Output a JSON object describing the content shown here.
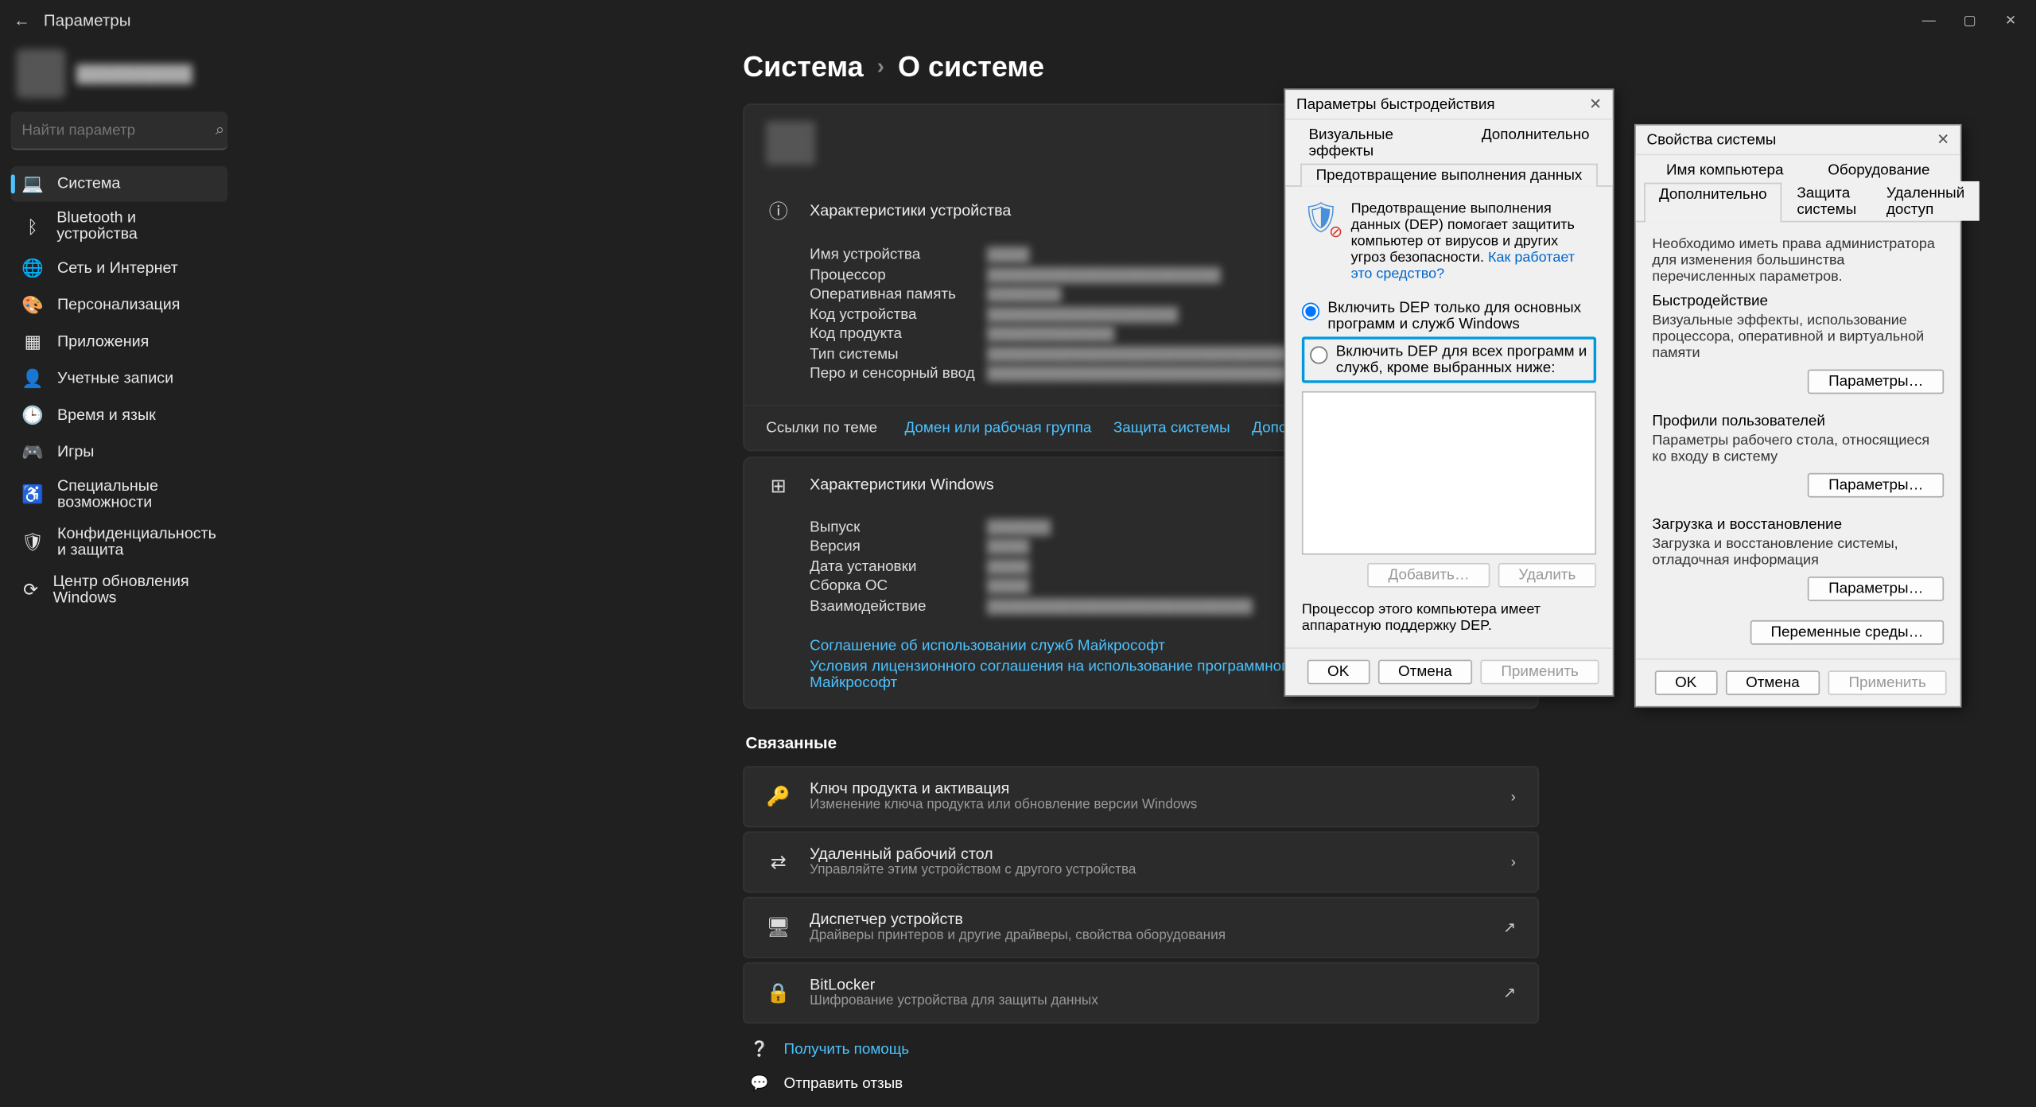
{
  "window": {
    "title": "Параметры",
    "back_aria": "Назад"
  },
  "search": {
    "placeholder": "Найти параметр"
  },
  "sidebar": {
    "items": [
      {
        "label": "Система",
        "icon": "💻",
        "active": true
      },
      {
        "label": "Bluetooth и устройства",
        "icon": "ᛒ"
      },
      {
        "label": "Сеть и Интернет",
        "icon": "🌐"
      },
      {
        "label": "Персонализация",
        "icon": "🎨"
      },
      {
        "label": "Приложения",
        "icon": "▦"
      },
      {
        "label": "Учетные записи",
        "icon": "👤"
      },
      {
        "label": "Время и язык",
        "icon": "🕒"
      },
      {
        "label": "Игры",
        "icon": "🎮"
      },
      {
        "label": "Специальные возможности",
        "icon": "♿"
      },
      {
        "label": "Конфиденциальность и защита",
        "icon": "🛡"
      },
      {
        "label": "Центр обновления Windows",
        "icon": "⟳"
      }
    ]
  },
  "breadcrumb": {
    "root": "Система",
    "page": "О системе"
  },
  "device_specs": {
    "title": "Характеристики устройства",
    "rows": [
      {
        "k": "Имя устройства",
        "v": "████"
      },
      {
        "k": "Процессор",
        "v": "██████████████████████"
      },
      {
        "k": "Оперативная память",
        "v": "███████"
      },
      {
        "k": "Код устройства",
        "v": "██████████████████"
      },
      {
        "k": "Код продукта",
        "v": "████████████"
      },
      {
        "k": "Тип системы",
        "v": "██████████████████████████████"
      },
      {
        "k": "Перо и сенсорный ввод",
        "v": "████████████████████████████████████"
      }
    ],
    "links_label": "Ссылки по теме",
    "links": [
      "Домен или рабочая группа",
      "Защита системы",
      "Дополнительные параметры сис"
    ]
  },
  "win_specs": {
    "title": "Характеристики Windows",
    "rows": [
      {
        "k": "Выпуск",
        "v": "██████"
      },
      {
        "k": "Версия",
        "v": "████"
      },
      {
        "k": "Дата установки",
        "v": "████"
      },
      {
        "k": "Сборка ОС",
        "v": "████"
      },
      {
        "k": "Взаимодействие",
        "v": "█████████████████████████"
      }
    ],
    "ms_services_link": "Соглашение об использовании служб Майкрософт",
    "ms_license_link": "Условия лицензионного соглашения на использование программного обеспечения корпорации Майкрософт"
  },
  "related": {
    "title": "Связанные",
    "items": [
      {
        "t": "Ключ продукта и активация",
        "s": "Изменение ключа продукта или обновление версии Windows",
        "icon": "🔑",
        "chev": "›"
      },
      {
        "t": "Удаленный рабочий стол",
        "s": "Управляйте этим устройством с другого устройства",
        "icon": "⇄",
        "chev": "›"
      },
      {
        "t": "Диспетчер устройств",
        "s": "Драйверы принтеров и другие драйверы, свойства оборудования",
        "icon": "🖥",
        "chev": "↗"
      },
      {
        "t": "BitLocker",
        "s": "Шифрование устройства для защиты данных",
        "icon": "🔒",
        "chev": "↗"
      }
    ]
  },
  "footer": {
    "help": "Получить помощь",
    "feedback": "Отправить отзыв"
  },
  "perf_dialog": {
    "title": "Параметры быстродействия",
    "tabs": {
      "row1": [
        "Визуальные эффекты",
        "Дополнительно"
      ],
      "row2_active": "Предотвращение выполнения данных"
    },
    "dep_desc": "Предотвращение выполнения данных (DEP) помогает защитить компьютер от вирусов и других угроз безопасности.",
    "dep_link": "Как работает это средство?",
    "radio1": "Включить DEP только для основных программ и служб Windows",
    "radio2": "Включить DEP для всех программ и служб, кроме выбранных ниже:",
    "add_btn": "Добавить…",
    "del_btn": "Удалить",
    "hw_note": "Процессор этого компьютера имеет аппаратную поддержку DEP.",
    "ok": "OK",
    "cancel": "Отмена",
    "apply": "Применить"
  },
  "sysprops_dialog": {
    "title": "Свойства системы",
    "tabs_row1": [
      "Имя компьютера",
      "Оборудование"
    ],
    "tabs_row2": [
      "Дополнительно",
      "Защита системы",
      "Удаленный доступ"
    ],
    "admin_note": "Необходимо иметь права администратора для изменения большинства перечисленных параметров.",
    "perf": {
      "title": "Быстродействие",
      "desc": "Визуальные эффекты, использование процессора, оперативной и виртуальной памяти"
    },
    "profiles": {
      "title": "Профили пользователей",
      "desc": "Параметры рабочего стола, относящиеся ко входу в систему"
    },
    "boot": {
      "title": "Загрузка и восстановление",
      "desc": "Загрузка и восстановление системы, отладочная информация"
    },
    "params_btn": "Параметры…",
    "env_btn": "Переменные среды…",
    "ok": "OK",
    "cancel": "Отмена",
    "apply": "Применить"
  }
}
